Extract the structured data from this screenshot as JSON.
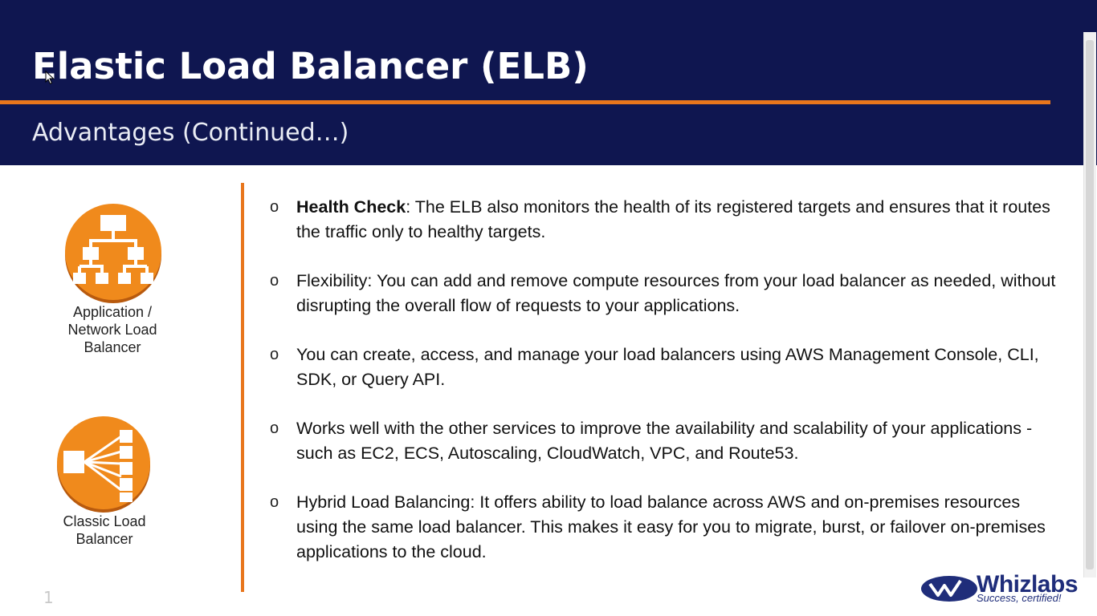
{
  "header": {
    "title": "Elastic Load Balancer (ELB)",
    "subtitle": "Advantages (Continued…)"
  },
  "sidebar": {
    "items": [
      {
        "label_lines": [
          "Application /",
          "Network Load",
          "Balancer"
        ],
        "icon": "application-load-balancer-icon"
      },
      {
        "label_lines": [
          "Classic Load",
          "Balancer"
        ],
        "icon": "classic-load-balancer-icon"
      }
    ]
  },
  "bullets": [
    {
      "bold": "Health Check",
      "text": ": The ELB also monitors the health of its registered targets and ensures that it routes the traffic only to healthy targets."
    },
    {
      "bold": "",
      "text": "Flexibility: You can add and remove compute resources from your load balancer as needed, without disrupting the overall flow of requests to your applications."
    },
    {
      "bold": "",
      "text": "You can create, access, and manage your load balancers using AWS Management Console, CLI, SDK, or Query API."
    },
    {
      "bold": "",
      "text": "Works well with the other services to improve the availability and scalability of your applications - such as EC2, ECS, Autoscaling, CloudWatch, VPC, and Route53."
    },
    {
      "bold": "",
      "text": "Hybrid Load Balancing: It offers ability to load balance across AWS and on-premises resources using the same load balancer. This makes it easy for you to migrate, burst, or failover on-premises applications to the cloud."
    }
  ],
  "bullet_marker": "o",
  "page_number": "1",
  "logo": {
    "name": "Whizlabs",
    "tagline": "Success, certified!"
  },
  "colors": {
    "header_bg": "#0f1650",
    "accent": "#e8761c",
    "logo": "#1f2d7a"
  }
}
